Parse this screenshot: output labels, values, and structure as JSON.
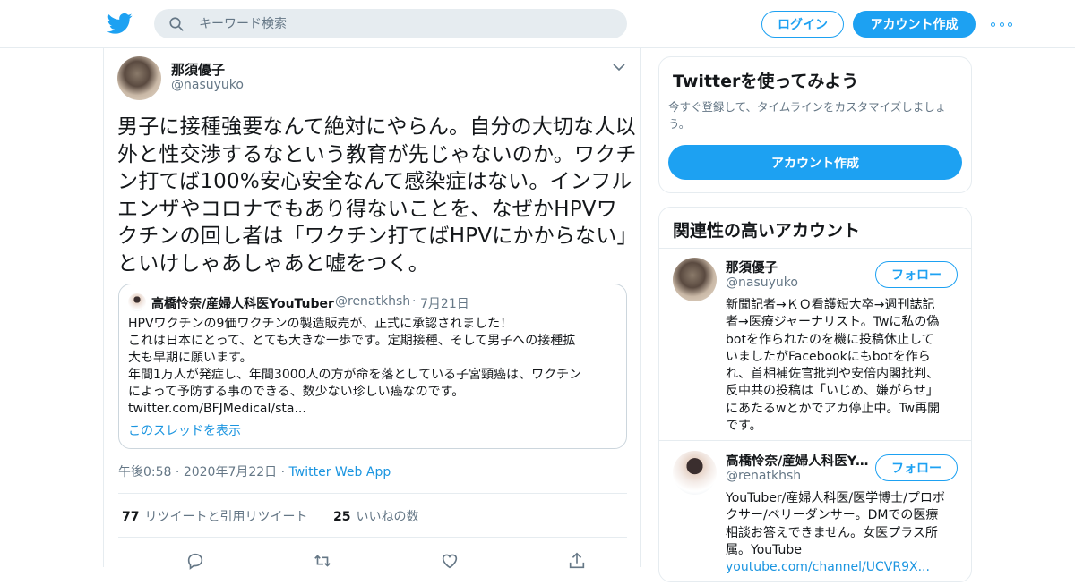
{
  "header": {
    "search_placeholder": "キーワード検索",
    "login_label": "ログイン",
    "signup_label": "アカウント作成",
    "brand_color": "#1da1f2"
  },
  "tweet": {
    "author_name": "那須優子",
    "author_handle": "@nasuyuko",
    "text": "男子に接種強要なんて絶対にやらん。自分の大切な人以外と性交渉するなという教育が先じゃないのか。ワクチン打てば100%安心安全なんて感染症はない。インフルエンザやコロナでもあり得ないことを、なぜかHPVワクチンの回し者は「ワクチン打てばHPVにかからない」といけしゃあしゃあと嘘をつく。",
    "quote": {
      "author_name": "高橋怜奈/産婦人科医YouTuber",
      "author_handle": "@renatkhsh",
      "separator": "·",
      "date": "7月21日",
      "lines": [
        "HPVワクチンの9価ワクチンの製造販売が、正式に承認されました！",
        "これは日本にとって、とても大きな一歩です。定期接種、そして男子への接種拡",
        "大も早期に願います。",
        "年間1万人が発症し、年間3000人の方が命を落としている子宮頸癌は、ワクチン",
        "によって予防する事のできる、数少ない珍しい癌なのです。",
        "twitter.com/BFJMedical/sta..."
      ],
      "thread_link": "このスレッドを表示"
    },
    "time": "午後0:58",
    "date": "2020年7月22日",
    "separator": "·",
    "source": "Twitter Web App",
    "retweets_count": "77",
    "retweets_label": "リツイートと引用リツイート",
    "likes_count": "25",
    "likes_label": "いいねの数"
  },
  "sidebar": {
    "signup_card": {
      "title": "Twitterを使ってみよう",
      "description": "今すぐ登録して、タイムラインをカスタマイズしましょう。",
      "button_label": "アカウント作成"
    },
    "related": {
      "title": "関連性の高いアカウント",
      "follow_label": "フォロー",
      "accounts": [
        {
          "name": "那須優子",
          "handle": "@nasuyuko",
          "bio_lines": [
            "新聞記者→ＫＯ看護短大卒→週刊誌記",
            "者→医療ジャーナリスト。Twに私の偽",
            "botを作られたのを機に投稿休止して",
            "いましたがFacebookにもbotを作ら",
            "れ、首相補佐官批判や安倍内閣批判、",
            "反中共の投稿は「いじめ、嫌がらせ」",
            "にあたるwとかでアカ停止中。Tw再開",
            "です。"
          ]
        },
        {
          "name": "高橋怜奈/産婦人科医YouTuber",
          "handle": "@renatkhsh",
          "bio_lines": [
            "YouTuber/産婦人科医/医学博士/プロボ",
            "クサー/ベリーダンサー。DMでの医療",
            "相談お答えできません。女医プラス所",
            "属。YouTube"
          ],
          "bio_link": "youtube.com/channel/UCVR9X..."
        }
      ]
    }
  }
}
